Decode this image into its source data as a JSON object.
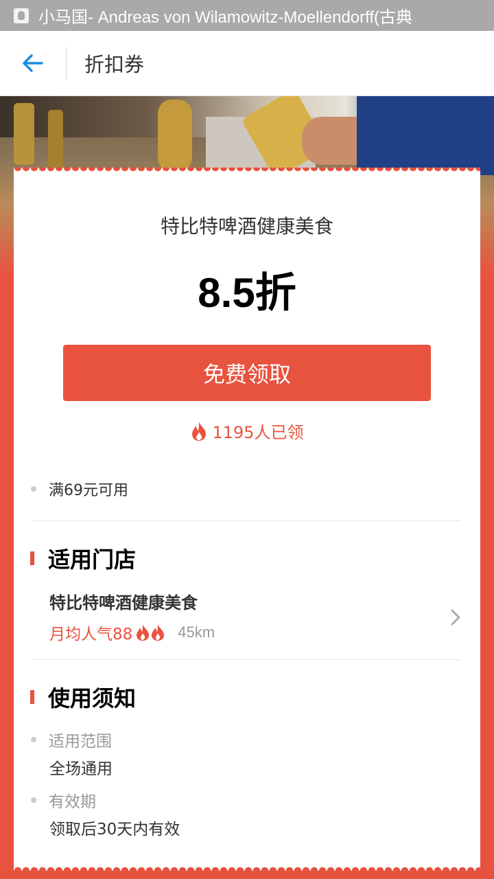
{
  "statusbar": {
    "title": "小马国- Andreas von Wilamowitz-Moellendorff(古典"
  },
  "header": {
    "title": "折扣券"
  },
  "coupon": {
    "shop_name": "特比特啤酒健康美食",
    "discount": "8.5折",
    "claim_button": "免费领取",
    "claimed_count": "1195人已领",
    "condition": "满69元可用"
  },
  "stores": {
    "heading": "适用门店",
    "name": "特比特啤酒健康美食",
    "popularity": "月均人气88",
    "distance": "45km"
  },
  "notice": {
    "heading": "使用须知",
    "items": [
      {
        "label": "适用范围",
        "value": "全场通用"
      },
      {
        "label": "有效期",
        "value": "领取后30天内有效"
      }
    ]
  },
  "colors": {
    "accent": "#e8533f",
    "header_back_icon": "#1a8ee0",
    "statusbar": "#a9a9a9"
  },
  "icons": {
    "back": "arrow-left-icon",
    "hot": "flame-icon",
    "more": "chevron-right-icon"
  }
}
